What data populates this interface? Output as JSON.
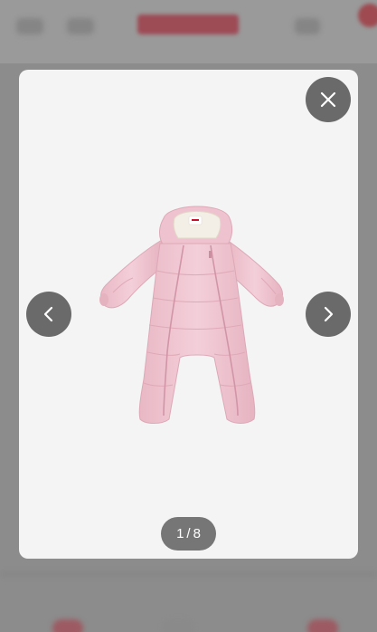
{
  "gallery": {
    "current": "1",
    "separator": "/",
    "total": "8",
    "product_image_alt": "",
    "product_color": "#f0c9d3"
  },
  "controls": {
    "close_icon": "close-icon",
    "prev_icon": "chevron-left-icon",
    "next_icon": "chevron-right-icon",
    "button_color": "#6a6a6a"
  },
  "overlay": {
    "backdrop_color": "#8c8c8c",
    "modal_color": "#f4f4f4"
  }
}
